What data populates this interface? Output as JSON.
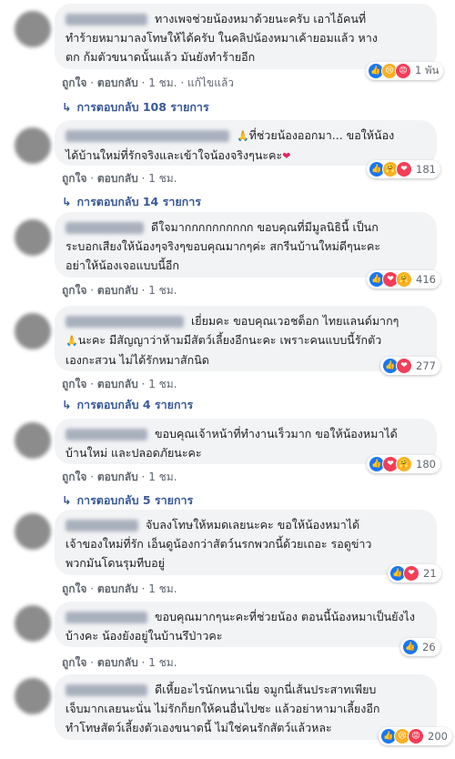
{
  "comments": [
    {
      "lines": [
        "ทางเพจช่วยน้องหมาด้วยนะครับ เอาไอ้คนที่",
        "ทำร้ายหมามาลงโทษให้ได้ครับ ในคลิปน้องหมาเค้ายอมแล้ว หาง",
        "ตก ก้มตัวขนาดนั้นแล้ว มันยังทำร้ายอีก"
      ],
      "reaction_count": "1 พัน",
      "reaction_icons": [
        "like-icon",
        "sad-icon",
        "angry-icon"
      ],
      "like": "ถูกใจ",
      "reply": "ตอบกลับ",
      "time": "1 ชม.",
      "edited": "แก้ไขแล้ว",
      "replies": "การตอบกลับ 108 รายการ"
    },
    {
      "lines": [
        "ที่ช่วยน้องออกมา... ขอให้น้อง",
        "ได้บ้านใหม่ที่รักจริงและเข้าใจน้องจริงๆนะคะ"
      ],
      "reaction_count": "181",
      "reaction_icons": [
        "like-icon",
        "care-icon",
        "love-icon"
      ],
      "like": "ถูกใจ",
      "reply": "ตอบกลับ",
      "time": "1 ชม.",
      "replies": "การตอบกลับ 14 รายการ"
    },
    {
      "lines": [
        "ดีใจมากกกกกกกกกก ขอบคุณที่มีมูลนิธินี้ เป็นก",
        "ระบอกเสียงให้น้องๆจริงๆขอบคุณมากๆค่ะ สกรีนบ้านใหม่ดีๆนะคะ",
        "อย่าให้น้องเจอแบบนี้อีก"
      ],
      "reaction_count": "416",
      "reaction_icons": [
        "like-icon",
        "love-icon",
        "care-icon"
      ],
      "like": "ถูกใจ",
      "reply": "ตอบกลับ",
      "time": "1 ชม."
    },
    {
      "lines": [
        "เยี่ยมคะ ขอบคุณเวอชต็อก ไทยแลนด์มากๆ",
        "นะคะ มีสัญญาว่าห้ามมีสัตว์เลี้ยงอีกนะคะ เพราะคนแบบนี้รักตัว",
        "เองกะสวน ไม่ได้รักหมาสักนิด"
      ],
      "reaction_count": "277",
      "reaction_icons": [
        "like-icon",
        "love-icon"
      ],
      "like": "ถูกใจ",
      "reply": "ตอบกลับ",
      "time": "1 ชม.",
      "replies": "การตอบกลับ 4 รายการ"
    },
    {
      "lines": [
        "ขอบคุณเจ้าหน้าที่ทำงานเร็วมาก ขอให้น้องหมาได้",
        "บ้านใหม่ และปลอดภัยนะคะ"
      ],
      "reaction_count": "180",
      "reaction_icons": [
        "like-icon",
        "love-icon",
        "care-icon"
      ],
      "like": "ถูกใจ",
      "reply": "ตอบกลับ",
      "time": "1 ชม.",
      "replies": "การตอบกลับ 5 รายการ"
    },
    {
      "lines": [
        "จับลงโทษให้หมดเลยนะคะ ขอให้น้องหมาได้",
        "เจ้าของใหม่ที่รัก เอ็นดูน้องกว่าสัตว์นรกพวกนี้ด้วยเถอะ รอดูข่าว",
        "พวกมันโดนรุมทีบอยู่"
      ],
      "reaction_count": "21",
      "reaction_icons": [
        "like-icon",
        "love-icon"
      ],
      "like": "ถูกใจ",
      "reply": "ตอบกลับ",
      "time": "1 ชม."
    },
    {
      "lines": [
        "ขอบคุณมากๆนะคะที่ช่วยน้อง ตอนนี้น้องหมาเป็นยังไง",
        "บ้างคะ น้องยังอยู่ในบ้านรึป่าวคะ"
      ],
      "reaction_count": "26",
      "reaction_icons": [
        "like-icon"
      ],
      "like": "ถูกใจ",
      "reply": "ตอบกลับ",
      "time": "1 ชม."
    },
    {
      "lines": [
        "ดีเหี้ยอะไรนักหนาเนี่ย จมูกนี่เส้นประสาทเพียบ",
        "เจ็บมากเลยนะนั่น ไม่รักก็ยกให้คนอื่นไปซะ แล้วอย่าหามาเลี้ยงอีก",
        "ทำโทษสัตว์เลี้ยงตัวเองขนาดนี้ ไม่ใช่คนรักสัตว์แล้วหละ"
      ],
      "reaction_count": "200",
      "reaction_icons": [
        "like-icon",
        "sad-icon",
        "angry-icon"
      ]
    }
  ],
  "colors": {
    "link": "#385898",
    "meta": "#606770",
    "bubble": "#f2f3f5",
    "like": "#1877f2",
    "love": "#f33e58"
  }
}
